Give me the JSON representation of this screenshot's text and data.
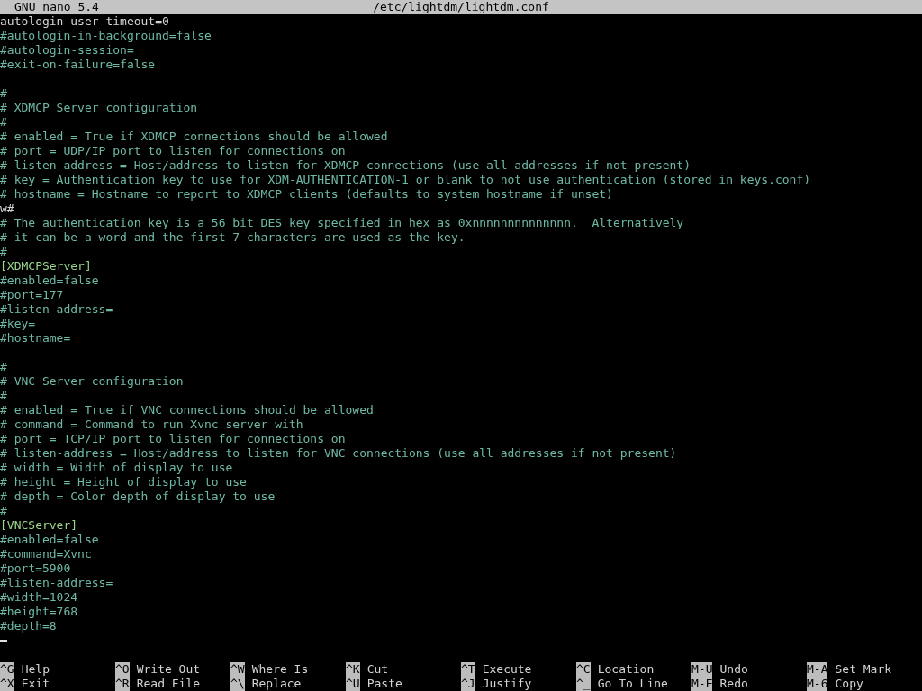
{
  "title_bar": {
    "app": "GNU nano 5.4",
    "file": "/etc/lightdm/lightdm.conf"
  },
  "lines": [
    {
      "kind": "plain",
      "text": "autologin-user-timeout=0"
    },
    {
      "kind": "comment",
      "text": "#autologin-in-background=false"
    },
    {
      "kind": "comment",
      "text": "#autologin-session="
    },
    {
      "kind": "comment",
      "text": "#exit-on-failure=false"
    },
    {
      "kind": "blank"
    },
    {
      "kind": "comment",
      "text": "#"
    },
    {
      "kind": "comment",
      "text": "# XDMCP Server configuration"
    },
    {
      "kind": "comment",
      "text": "#"
    },
    {
      "kind": "comment",
      "text": "# enabled = True if XDMCP connections should be allowed"
    },
    {
      "kind": "comment",
      "text": "# port = UDP/IP port to listen for connections on"
    },
    {
      "kind": "comment",
      "text": "# listen-address = Host/address to listen for XDMCP connections (use all addresses if not present)"
    },
    {
      "kind": "comment",
      "text": "# key = Authentication key to use for XDM-AUTHENTICATION-1 or blank to not use authentication (stored in keys.conf)"
    },
    {
      "kind": "comment",
      "text": "# hostname = Hostname to report to XDMCP clients (defaults to system hostname if unset)"
    },
    {
      "kind": "plain",
      "text": "w#"
    },
    {
      "kind": "comment",
      "text": "# The authentication key is a 56 bit DES key specified in hex as 0xnnnnnnnnnnnnnn.  Alternatively"
    },
    {
      "kind": "comment",
      "text": "# it can be a word and the first 7 characters are used as the key."
    },
    {
      "kind": "comment",
      "text": "#"
    },
    {
      "kind": "section",
      "text": "[XDMCPServer]"
    },
    {
      "kind": "comment",
      "text": "#enabled=false"
    },
    {
      "kind": "comment",
      "text": "#port=177"
    },
    {
      "kind": "comment",
      "text": "#listen-address="
    },
    {
      "kind": "comment",
      "text": "#key="
    },
    {
      "kind": "comment",
      "text": "#hostname="
    },
    {
      "kind": "blank"
    },
    {
      "kind": "comment",
      "text": "#"
    },
    {
      "kind": "comment",
      "text": "# VNC Server configuration"
    },
    {
      "kind": "comment",
      "text": "#"
    },
    {
      "kind": "comment",
      "text": "# enabled = True if VNC connections should be allowed"
    },
    {
      "kind": "comment",
      "text": "# command = Command to run Xvnc server with"
    },
    {
      "kind": "comment",
      "text": "# port = TCP/IP port to listen for connections on"
    },
    {
      "kind": "comment",
      "text": "# listen-address = Host/address to listen for VNC connections (use all addresses if not present)"
    },
    {
      "kind": "comment",
      "text": "# width = Width of display to use"
    },
    {
      "kind": "comment",
      "text": "# height = Height of display to use"
    },
    {
      "kind": "comment",
      "text": "# depth = Color depth of display to use"
    },
    {
      "kind": "comment",
      "text": "#"
    },
    {
      "kind": "section",
      "text": "[VNCServer]"
    },
    {
      "kind": "comment",
      "text": "#enabled=false"
    },
    {
      "kind": "comment",
      "text": "#command=Xvnc"
    },
    {
      "kind": "comment",
      "text": "#port=5900"
    },
    {
      "kind": "comment",
      "text": "#listen-address="
    },
    {
      "kind": "comment",
      "text": "#width=1024"
    },
    {
      "kind": "comment",
      "text": "#height=768"
    },
    {
      "kind": "comment",
      "text": "#depth=8"
    },
    {
      "kind": "cursor"
    }
  ],
  "shortcut_rows": [
    [
      {
        "key": "^G",
        "label": "Help"
      },
      {
        "key": "^O",
        "label": "Write Out"
      },
      {
        "key": "^W",
        "label": "Where Is"
      },
      {
        "key": "^K",
        "label": "Cut"
      },
      {
        "key": "^T",
        "label": "Execute"
      },
      {
        "key": "^C",
        "label": "Location"
      },
      {
        "key": "M-U",
        "label": "Undo"
      },
      {
        "key": "M-A",
        "label": "Set Mark"
      }
    ],
    [
      {
        "key": "^X",
        "label": "Exit"
      },
      {
        "key": "^R",
        "label": "Read File"
      },
      {
        "key": "^\\",
        "label": "Replace"
      },
      {
        "key": "^U",
        "label": "Paste"
      },
      {
        "key": "^J",
        "label": "Justify"
      },
      {
        "key": "^_",
        "label": "Go To Line"
      },
      {
        "key": "M-E",
        "label": "Redo"
      },
      {
        "key": "M-6",
        "label": "Copy"
      }
    ]
  ]
}
